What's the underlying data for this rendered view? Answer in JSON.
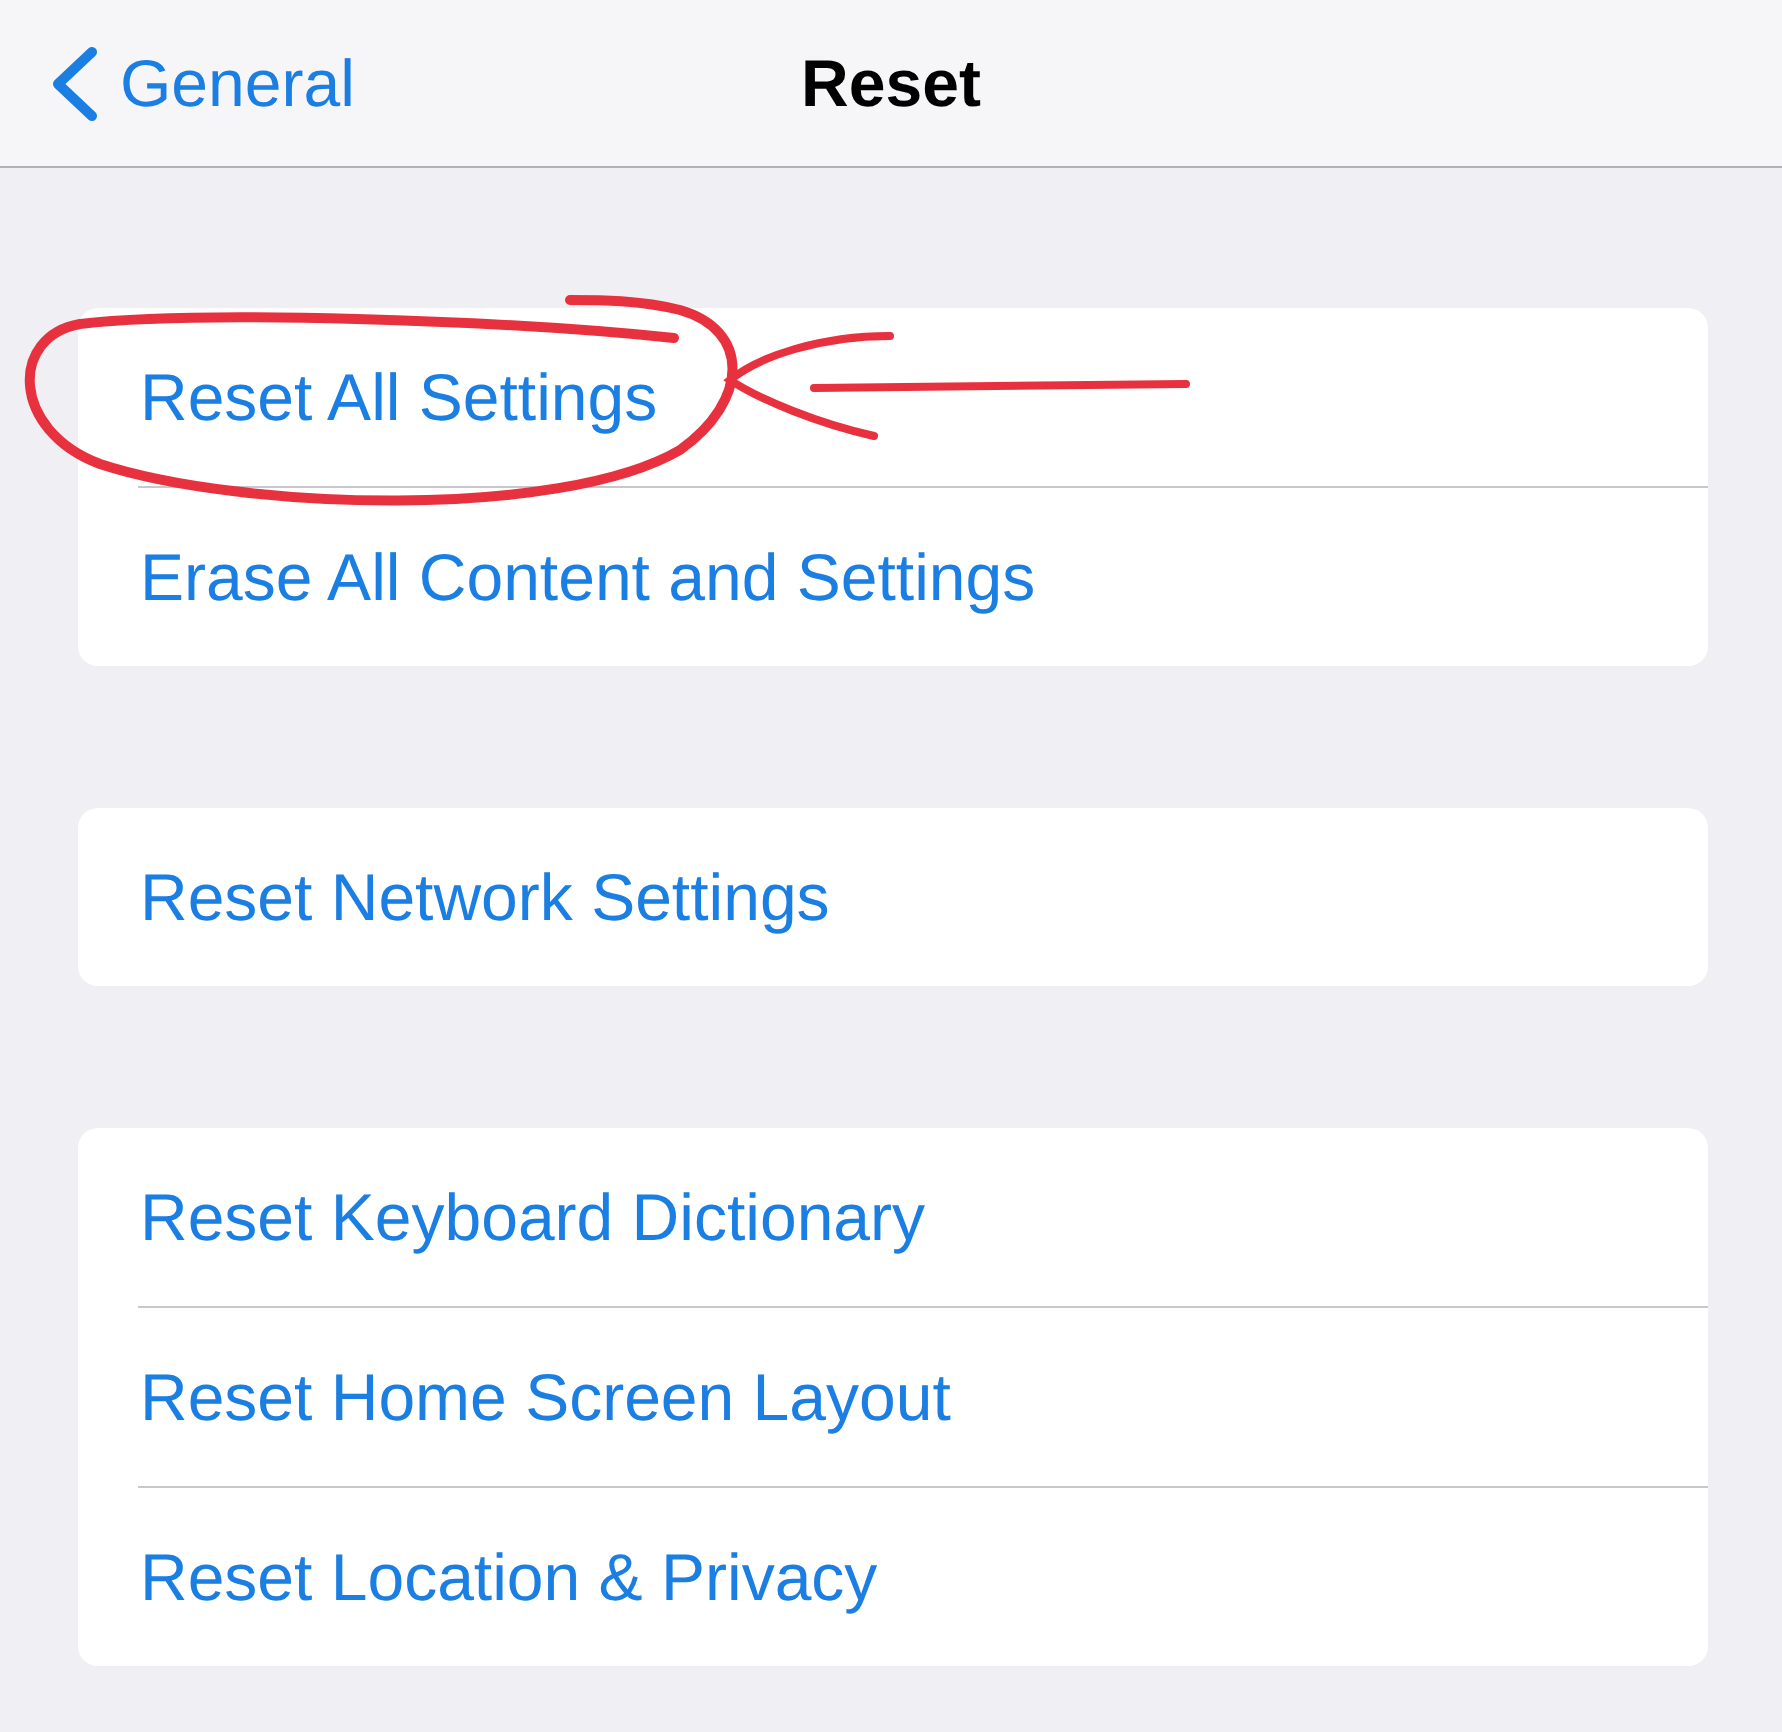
{
  "nav_bar": {
    "back_label": "General",
    "title": "Reset"
  },
  "groups": [
    {
      "rows": [
        {
          "label": "Reset All Settings",
          "circled": true
        },
        {
          "label": "Erase All Content and Settings",
          "circled": false
        }
      ]
    },
    {
      "rows": [
        {
          "label": "Reset Network Settings",
          "circled": false
        }
      ]
    },
    {
      "rows": [
        {
          "label": "Reset Keyboard Dictionary",
          "circled": false
        },
        {
          "label": "Reset Home Screen Layout",
          "circled": false
        },
        {
          "label": "Reset Location & Privacy",
          "circled": false
        }
      ]
    }
  ]
}
